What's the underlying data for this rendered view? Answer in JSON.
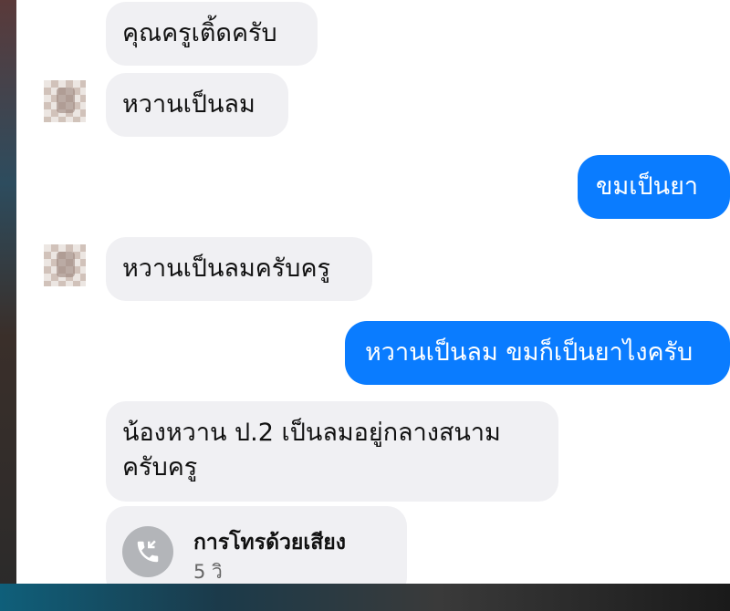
{
  "messages": [
    {
      "side": "in",
      "text": "คุณครูเติ้ดครับ"
    },
    {
      "side": "in",
      "text": "หวานเป็นลม"
    },
    {
      "side": "out",
      "text": "ขมเป็นยา"
    },
    {
      "side": "in",
      "text": "หวานเป็นลมครับครู"
    },
    {
      "side": "out",
      "text": "หวานเป็นลม ขมก็เป็นยาไงครับ"
    },
    {
      "side": "in",
      "lines": [
        "น้องหวาน ป.2 เป็นลมอยู่กลางสนาม",
        "ครับครู"
      ]
    }
  ],
  "voice_call": {
    "title": "การโทรด้วยเสียง",
    "duration": "5 วิ",
    "icon": "phone-callback-icon"
  },
  "colors": {
    "outgoing_bubble": "#0a7cff",
    "incoming_bubble": "#f0f0f3",
    "call_icon_bg": "#b3b5b9"
  }
}
